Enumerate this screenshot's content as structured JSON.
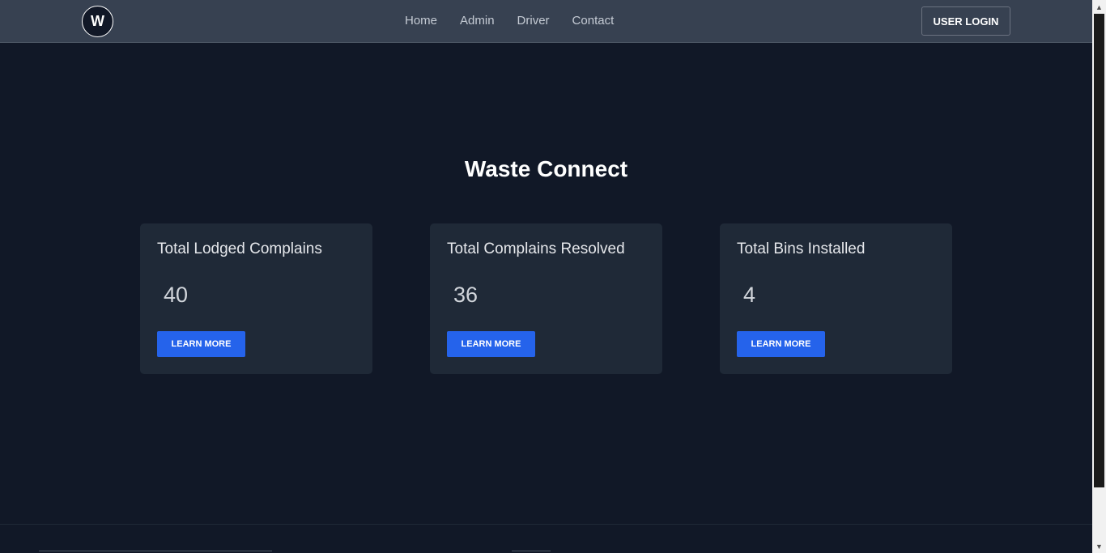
{
  "navbar": {
    "logo_letter": "W",
    "links": [
      "Home",
      "Admin",
      "Driver",
      "Contact"
    ],
    "login_label": "USER LOGIN"
  },
  "hero": {
    "title": "Waste Connect"
  },
  "cards": [
    {
      "title": "Total Lodged Complains",
      "value": "40",
      "button_label": "LEARN MORE"
    },
    {
      "title": "Total Complains Resolved",
      "value": "36",
      "button_label": "LEARN MORE"
    },
    {
      "title": "Total Bins Installed",
      "value": "4",
      "button_label": "LEARN MORE"
    }
  ],
  "colors": {
    "background": "#111827",
    "navbar": "#374151",
    "card": "#1f2937",
    "accent": "#2563eb"
  },
  "icons": {
    "scroll_up": "triangle-up-icon",
    "scroll_down": "triangle-down-icon"
  }
}
